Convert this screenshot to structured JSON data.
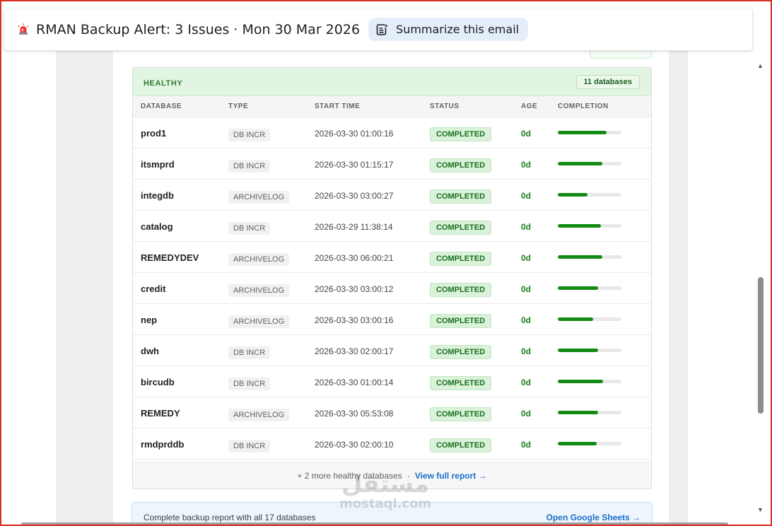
{
  "header": {
    "subject": "RMAN Backup Alert: 3 Issues · Mon 30 Mar 2026",
    "summarize_label": "Summarize this email"
  },
  "healthy": {
    "title": "HEALTHY",
    "count": "11 databases",
    "columns": [
      "DATABASE",
      "TYPE",
      "START TIME",
      "STATUS",
      "AGE",
      "COMPLETION"
    ],
    "rows": [
      {
        "db": "prod1",
        "type": "DB INCR",
        "start": "2026-03-30 01:00:16",
        "status": "COMPLETED",
        "age": "0d",
        "completion": 0.77
      },
      {
        "db": "itsmprd",
        "type": "DB INCR",
        "start": "2026-03-30 01:15:17",
        "status": "COMPLETED",
        "age": "0d",
        "completion": 0.7
      },
      {
        "db": "integdb",
        "type": "ARCHIVELOG",
        "start": "2026-03-30 03:00:27",
        "status": "COMPLETED",
        "age": "0d",
        "completion": 0.47
      },
      {
        "db": "catalog",
        "type": "DB INCR",
        "start": "2026-03-29 11:38:14",
        "status": "COMPLETED",
        "age": "0d",
        "completion": 0.68
      },
      {
        "db": "REMEDYDEV",
        "type": "ARCHIVELOG",
        "start": "2026-03-30 06:00:21",
        "status": "COMPLETED",
        "age": "0d",
        "completion": 0.7
      },
      {
        "db": "credit",
        "type": "ARCHIVELOG",
        "start": "2026-03-30 03:00:12",
        "status": "COMPLETED",
        "age": "0d",
        "completion": 0.63
      },
      {
        "db": "nep",
        "type": "ARCHIVELOG",
        "start": "2026-03-30 03:00:16",
        "status": "COMPLETED",
        "age": "0d",
        "completion": 0.56
      },
      {
        "db": "dwh",
        "type": "DB INCR",
        "start": "2026-03-30 02:00:17",
        "status": "COMPLETED",
        "age": "0d",
        "completion": 0.63
      },
      {
        "db": "bircudb",
        "type": "DB INCR",
        "start": "2026-03-30 01:00:14",
        "status": "COMPLETED",
        "age": "0d",
        "completion": 0.71
      },
      {
        "db": "REMEDY",
        "type": "ARCHIVELOG",
        "start": "2026-03-30 05:53:08",
        "status": "COMPLETED",
        "age": "0d",
        "completion": 0.63
      },
      {
        "db": "rmdprddb",
        "type": "DB INCR",
        "start": "2026-03-30 02:00:10",
        "status": "COMPLETED",
        "age": "0d",
        "completion": 0.61
      }
    ],
    "footer_text": "+ 2 more healthy databases",
    "footer_sep": "·",
    "footer_link": "View full report →"
  },
  "info": {
    "text": "Complete backup report with all 17 databases",
    "link": "Open Google Sheets →"
  },
  "watermark": {
    "arabic": "مستقل",
    "latin": "mostaql.com"
  },
  "colors": {
    "progress": "#138a14",
    "healthy_header_bg": "#e2f4e2",
    "status_bg": "#d9f2d9",
    "link": "#1a6fc9",
    "frame": "#d93025"
  },
  "icons": {
    "subject": "siren-icon",
    "summarize": "sparkle-document-icon"
  }
}
